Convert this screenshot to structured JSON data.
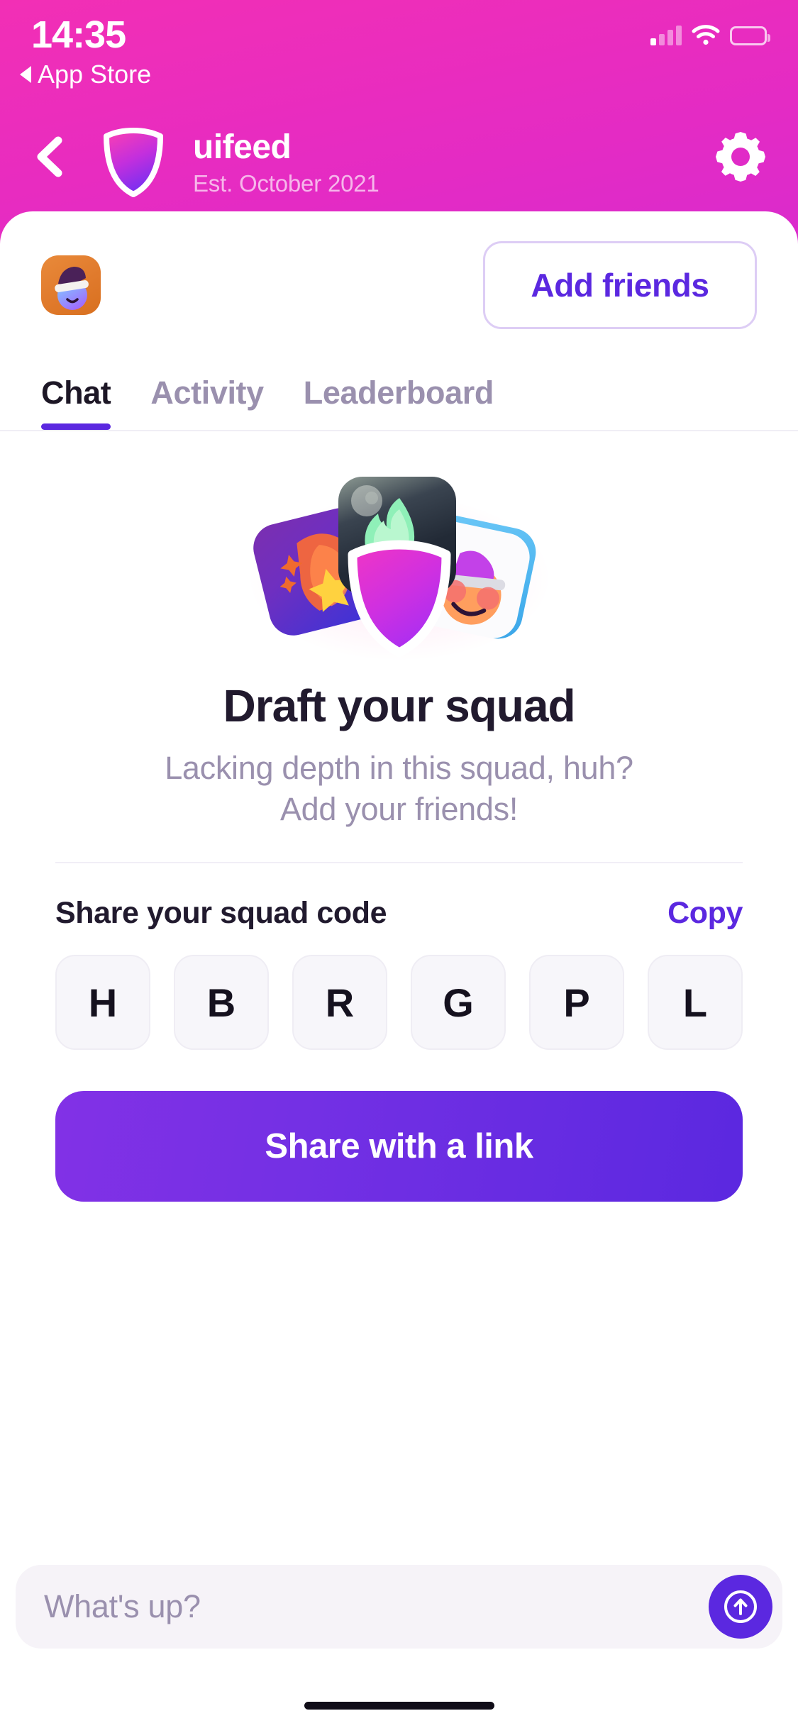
{
  "status_bar": {
    "time": "14:35",
    "back_label": "App Store",
    "signal_icon": "cellular-signal-icon",
    "wifi_icon": "wifi-icon",
    "battery_icon": "battery-icon"
  },
  "nav": {
    "back_icon": "chevron-left-icon",
    "logo_icon": "shield-logo-icon",
    "title": "uifeed",
    "subtitle": "Est. October 2021",
    "settings_icon": "gear-icon"
  },
  "header": {
    "avatar_icon": "user-avatar",
    "add_friends_label": "Add friends"
  },
  "tabs": [
    {
      "label": "Chat",
      "active": true
    },
    {
      "label": "Activity",
      "active": false
    },
    {
      "label": "Leaderboard",
      "active": false
    }
  ],
  "empty_state": {
    "illustration_icon": "squad-shields-illustration",
    "title": "Draft your squad",
    "subtitle_line1": "Lacking depth in this squad, huh?",
    "subtitle_line2": "Add your friends!"
  },
  "share_code": {
    "label": "Share your squad code",
    "copy_label": "Copy",
    "code": [
      "H",
      "B",
      "R",
      "G",
      "P",
      "L"
    ],
    "share_button_label": "Share with a link"
  },
  "composer": {
    "placeholder": "What's up?",
    "value": "",
    "send_icon": "arrow-up-circle-icon"
  },
  "colors": {
    "accent": "#5b28e0",
    "header_gradient_start": "#f22fb5",
    "header_gradient_end": "#9327f4",
    "muted_text": "#9a90ae",
    "dark_text": "#211a2e"
  }
}
